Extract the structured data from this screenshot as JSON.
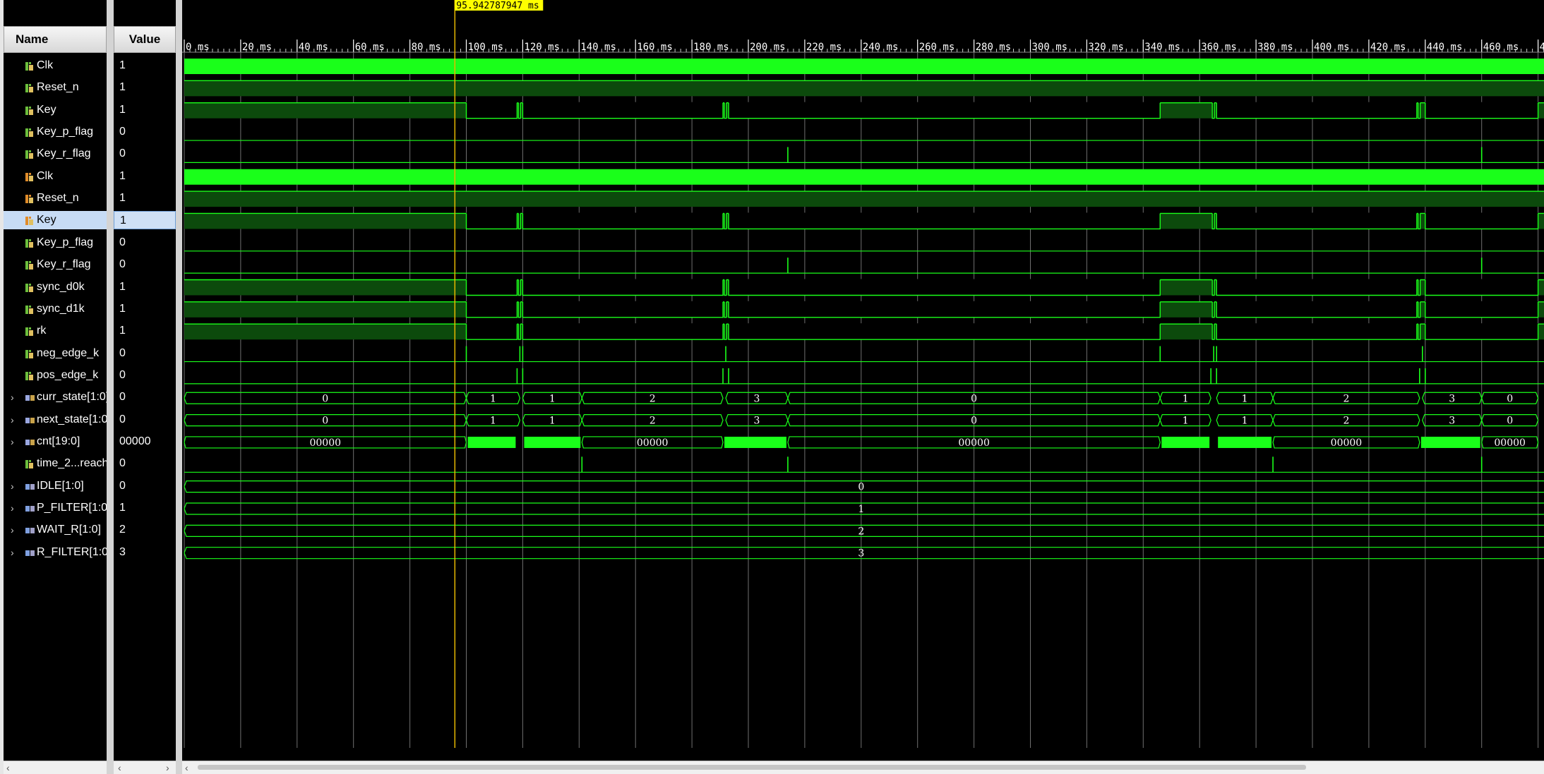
{
  "headers": {
    "name": "Name",
    "value": "Value"
  },
  "cursor": {
    "time_ms": 95.942787947,
    "label": "95.942787947 ms"
  },
  "timeline": {
    "max_ms": 480,
    "tick_step_ms": 20,
    "minor_divisions": 10,
    "unit": "ms"
  },
  "colors": {
    "wave": "#1aff1a",
    "wave_fill": "#0c4a0c",
    "grid": "#707070",
    "cursor": "#e6b800",
    "cursor_label_bg": "#ffff00",
    "text_on_wave": "#ffffff"
  },
  "signals": [
    {
      "name": "Clk",
      "value": "1",
      "kind": "bit",
      "icon": "signal-icon-green",
      "wave": "clock"
    },
    {
      "name": "Reset_n",
      "value": "1",
      "kind": "bit",
      "icon": "signal-icon-green",
      "wave": "high"
    },
    {
      "name": "Key",
      "value": "1",
      "kind": "bit",
      "icon": "signal-icon-green",
      "wave": "key"
    },
    {
      "name": "Key_p_flag",
      "value": "0",
      "kind": "bit",
      "icon": "signal-icon-green",
      "wave": "low",
      "pulses": []
    },
    {
      "name": "Key_r_flag",
      "value": "0",
      "kind": "bit",
      "icon": "signal-icon-green",
      "wave": "low",
      "pulses": [
        214,
        460
      ]
    },
    {
      "name": "Clk",
      "value": "1",
      "kind": "bit",
      "icon": "signal-icon-orange",
      "wave": "clock"
    },
    {
      "name": "Reset_n",
      "value": "1",
      "kind": "bit",
      "icon": "signal-icon-orange",
      "wave": "high"
    },
    {
      "name": "Key",
      "value": "1",
      "kind": "bit",
      "icon": "signal-icon-orange",
      "wave": "key",
      "selected": true
    },
    {
      "name": "Key_p_flag",
      "value": "0",
      "kind": "bit",
      "icon": "signal-icon-green",
      "wave": "low",
      "pulses": []
    },
    {
      "name": "Key_r_flag",
      "value": "0",
      "kind": "bit",
      "icon": "signal-icon-green",
      "wave": "low",
      "pulses": [
        214,
        460
      ]
    },
    {
      "name": "sync_d0k",
      "value": "1",
      "kind": "bit",
      "icon": "signal-icon-green",
      "wave": "key"
    },
    {
      "name": "sync_d1k",
      "value": "1",
      "kind": "bit",
      "icon": "signal-icon-green",
      "wave": "key"
    },
    {
      "name": "rk",
      "value": "1",
      "kind": "bit",
      "icon": "signal-icon-green",
      "wave": "key"
    },
    {
      "name": "neg_edge_k",
      "value": "0",
      "kind": "bit",
      "icon": "signal-icon-green",
      "wave": "low",
      "pulses": [
        100,
        119,
        120,
        192,
        346,
        365,
        366,
        439
      ]
    },
    {
      "name": "pos_edge_k",
      "value": "0",
      "kind": "bit",
      "icon": "signal-icon-green",
      "wave": "low",
      "pulses": [
        118,
        120,
        191,
        193,
        364,
        366,
        438,
        440
      ]
    },
    {
      "name": "curr_state[1:0]",
      "value": "0",
      "kind": "bus",
      "icon": "bus-icon",
      "wave": "state"
    },
    {
      "name": "next_state[1:0]",
      "value": "0",
      "kind": "bus",
      "icon": "bus-icon",
      "wave": "state"
    },
    {
      "name": "cnt[19:0]",
      "value": "00000",
      "kind": "bus",
      "icon": "bus-icon",
      "wave": "cnt"
    },
    {
      "name": "time_2...reach",
      "value": "0",
      "kind": "bit",
      "icon": "signal-icon-green",
      "wave": "low",
      "pulses": [
        141,
        214,
        386,
        460
      ]
    },
    {
      "name": "IDLE[1:0]",
      "value": "0",
      "kind": "param",
      "icon": "param-icon",
      "wave": "const",
      "const": "0"
    },
    {
      "name": "P_FILTER[1:0]",
      "value": "1",
      "kind": "param",
      "icon": "param-icon",
      "wave": "const",
      "const": "1"
    },
    {
      "name": "WAIT_R[1:0]",
      "value": "2",
      "kind": "param",
      "icon": "param-icon",
      "wave": "const",
      "const": "2"
    },
    {
      "name": "R_FILTER[1:0]",
      "value": "3",
      "kind": "param",
      "icon": "param-icon",
      "wave": "const",
      "const": "3"
    }
  ],
  "key_low_intervals_ms": [
    [
      100,
      118
    ],
    [
      120,
      191
    ],
    [
      193,
      346
    ],
    [
      366,
      437
    ],
    [
      440,
      480
    ]
  ],
  "key_short_low_intervals_ms": [
    [
      118.5,
      119.2
    ],
    [
      191.5,
      192.2
    ],
    [
      364.5,
      365.2
    ],
    [
      437.5,
      438.2
    ]
  ],
  "state_segments": [
    {
      "from": 0,
      "to": 100,
      "label": "0"
    },
    {
      "from": 100,
      "to": 119,
      "label": "1"
    },
    {
      "from": 120,
      "to": 141,
      "label": "1"
    },
    {
      "from": 141,
      "to": 191,
      "label": "2"
    },
    {
      "from": 192,
      "to": 214,
      "label": "3"
    },
    {
      "from": 214,
      "to": 346,
      "label": "0"
    },
    {
      "from": 346,
      "to": 364,
      "label": "1"
    },
    {
      "from": 366,
      "to": 386,
      "label": "1"
    },
    {
      "from": 386,
      "to": 438,
      "label": "2"
    },
    {
      "from": 439,
      "to": 460,
      "label": "3"
    },
    {
      "from": 460,
      "to": 480,
      "label": "0"
    }
  ],
  "cnt_segments": [
    {
      "from": 0,
      "to": 100,
      "label": "00000",
      "busy": false
    },
    {
      "from": 100,
      "to": 118,
      "label": "",
      "busy": true
    },
    {
      "from": 120,
      "to": 141,
      "label": "",
      "busy": true
    },
    {
      "from": 141,
      "to": 191,
      "label": "00000",
      "busy": false
    },
    {
      "from": 191,
      "to": 214,
      "label": "",
      "busy": true
    },
    {
      "from": 214,
      "to": 346,
      "label": "00000",
      "busy": false
    },
    {
      "from": 346,
      "to": 364,
      "label": "",
      "busy": true
    },
    {
      "from": 366,
      "to": 386,
      "label": "",
      "busy": true
    },
    {
      "from": 386,
      "to": 438,
      "label": "00000",
      "busy": false
    },
    {
      "from": 438,
      "to": 460,
      "label": "",
      "busy": true
    },
    {
      "from": 460,
      "to": 480,
      "label": "00000",
      "busy": false
    }
  ]
}
